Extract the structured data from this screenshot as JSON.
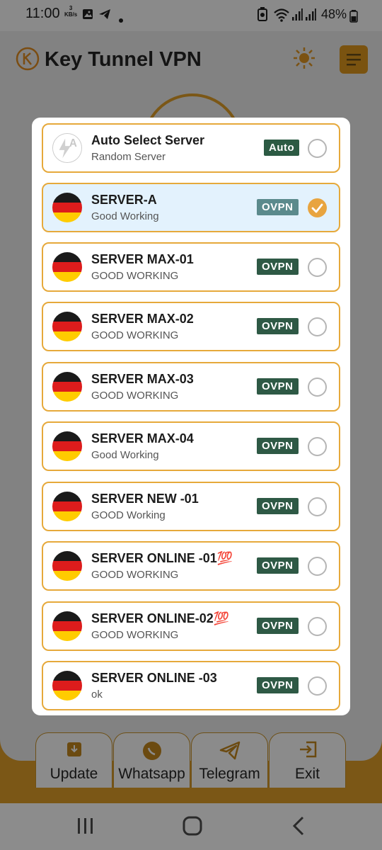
{
  "status_bar": {
    "time": "11:00",
    "net_speed_value": "3",
    "net_speed_unit": "KB/s",
    "battery": "48%"
  },
  "app": {
    "title": "Key Tunnel VPN",
    "tabs": [
      {
        "label": "Update",
        "icon": "download-icon"
      },
      {
        "label": "Whatsapp",
        "icon": "whatsapp-icon"
      },
      {
        "label": "Telegram",
        "icon": "telegram-icon"
      },
      {
        "label": "Exit",
        "icon": "exit-icon"
      }
    ]
  },
  "dialog": {
    "servers": [
      {
        "title": "Auto Select Server",
        "subtitle": "Random Server",
        "badge": "Auto",
        "icon": "auto-select-icon",
        "selected": false
      },
      {
        "title": "SERVER-A",
        "subtitle": "Good Working",
        "badge": "OVPN",
        "icon": "germany-flag-icon",
        "selected": true
      },
      {
        "title": "SERVER MAX-01",
        "subtitle": "GOOD WORKING",
        "badge": "OVPN",
        "icon": "germany-flag-icon",
        "selected": false
      },
      {
        "title": "SERVER MAX-02",
        "subtitle": "GOOD WORKING",
        "badge": "OVPN",
        "icon": "germany-flag-icon",
        "selected": false
      },
      {
        "title": "SERVER MAX-03",
        "subtitle": "GOOD WORKING",
        "badge": "OVPN",
        "icon": "germany-flag-icon",
        "selected": false
      },
      {
        "title": "SERVER MAX-04",
        "subtitle": "Good Working",
        "badge": "OVPN",
        "icon": "germany-flag-icon",
        "selected": false
      },
      {
        "title": "SERVER NEW -01",
        "subtitle": "GOOD Working",
        "badge": "OVPN",
        "icon": "germany-flag-icon",
        "selected": false
      },
      {
        "title": "SERVER ONLINE -01💯",
        "subtitle": "GOOD WORKING",
        "badge": "OVPN",
        "icon": "germany-flag-icon",
        "selected": false
      },
      {
        "title": "SERVER ONLINE-02💯",
        "subtitle": "GOOD WORKING",
        "badge": "OVPN",
        "icon": "germany-flag-icon",
        "selected": false
      },
      {
        "title": "SERVER ONLINE -03",
        "subtitle": "ok",
        "badge": "OVPN",
        "icon": "germany-flag-icon",
        "selected": false
      }
    ]
  },
  "colors": {
    "accent": "#e6a93b",
    "badge_bg": "#2e5945",
    "selected_row_bg": "#e3f2fd"
  }
}
